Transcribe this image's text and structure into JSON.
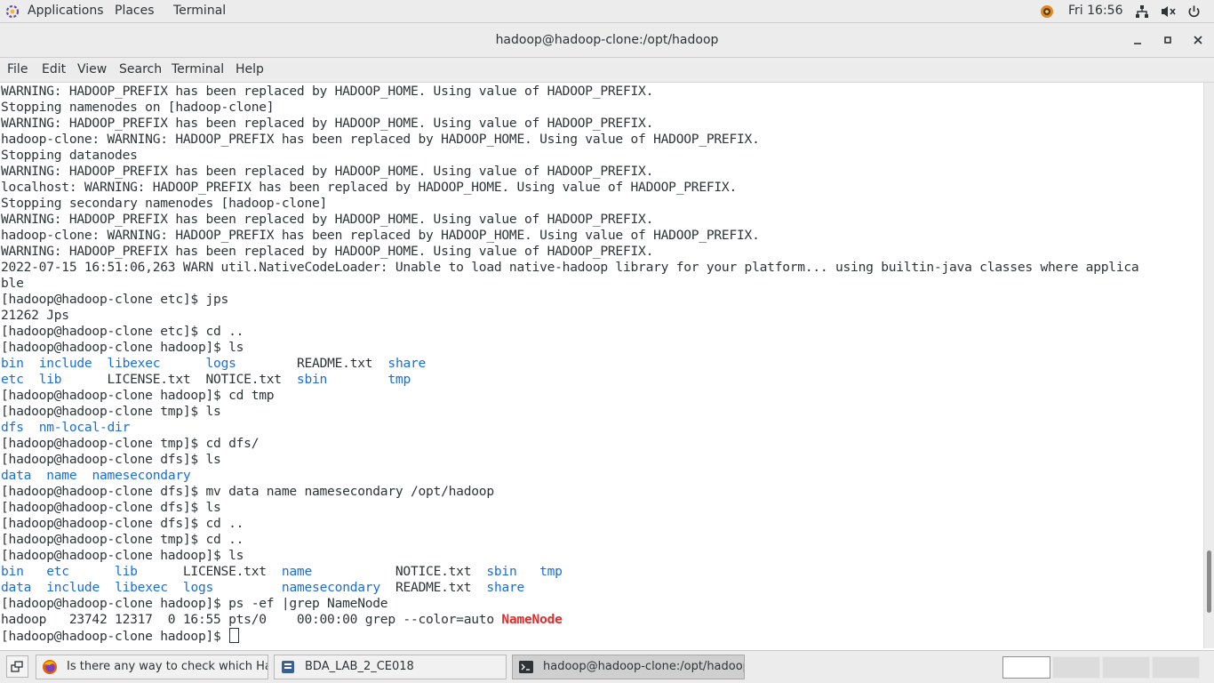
{
  "topbar": {
    "applications": "Applications",
    "places": "Places",
    "terminal": "Terminal",
    "clock": "Fri 16:56"
  },
  "window": {
    "title": "hadoop@hadoop-clone:/opt/hadoop"
  },
  "menubar": {
    "items": [
      "File",
      "Edit",
      "View",
      "Search",
      "Terminal",
      "Help"
    ]
  },
  "terminal": {
    "lines": [
      [
        {
          "t": "WARNING: HADOOP_PREFIX has been replaced by HADOOP_HOME. Using value of HADOOP_PREFIX."
        }
      ],
      [
        {
          "t": "Stopping namenodes on [hadoop-clone]"
        }
      ],
      [
        {
          "t": "WARNING: HADOOP_PREFIX has been replaced by HADOOP_HOME. Using value of HADOOP_PREFIX."
        }
      ],
      [
        {
          "t": "hadoop-clone: WARNING: HADOOP_PREFIX has been replaced by HADOOP_HOME. Using value of HADOOP_PREFIX."
        }
      ],
      [
        {
          "t": "Stopping datanodes"
        }
      ],
      [
        {
          "t": "WARNING: HADOOP_PREFIX has been replaced by HADOOP_HOME. Using value of HADOOP_PREFIX."
        }
      ],
      [
        {
          "t": "localhost: WARNING: HADOOP_PREFIX has been replaced by HADOOP_HOME. Using value of HADOOP_PREFIX."
        }
      ],
      [
        {
          "t": "Stopping secondary namenodes [hadoop-clone]"
        }
      ],
      [
        {
          "t": "WARNING: HADOOP_PREFIX has been replaced by HADOOP_HOME. Using value of HADOOP_PREFIX."
        }
      ],
      [
        {
          "t": "hadoop-clone: WARNING: HADOOP_PREFIX has been replaced by HADOOP_HOME. Using value of HADOOP_PREFIX."
        }
      ],
      [
        {
          "t": "WARNING: HADOOP_PREFIX has been replaced by HADOOP_HOME. Using value of HADOOP_PREFIX."
        }
      ],
      [
        {
          "t": "2022-07-15 16:51:06,263 WARN util.NativeCodeLoader: Unable to load native-hadoop library for your platform... using builtin-java classes where applica"
        }
      ],
      [
        {
          "t": "ble"
        }
      ],
      [
        {
          "t": "[hadoop@hadoop-clone etc]$ jps"
        }
      ],
      [
        {
          "t": "21262 Jps"
        }
      ],
      [
        {
          "t": "[hadoop@hadoop-clone etc]$ cd .."
        }
      ],
      [
        {
          "t": "[hadoop@hadoop-clone hadoop]$ ls"
        }
      ],
      [
        {
          "t": "bin",
          "c": "dir"
        },
        {
          "t": "  "
        },
        {
          "t": "include",
          "c": "dir"
        },
        {
          "t": "  "
        },
        {
          "t": "libexec",
          "c": "dir"
        },
        {
          "t": "      "
        },
        {
          "t": "logs",
          "c": "dir"
        },
        {
          "t": "        README.txt  "
        },
        {
          "t": "share",
          "c": "dir"
        }
      ],
      [
        {
          "t": "etc",
          "c": "dir"
        },
        {
          "t": "  "
        },
        {
          "t": "lib",
          "c": "dir"
        },
        {
          "t": "      LICENSE.txt  NOTICE.txt  "
        },
        {
          "t": "sbin",
          "c": "dir"
        },
        {
          "t": "        "
        },
        {
          "t": "tmp",
          "c": "dir"
        }
      ],
      [
        {
          "t": "[hadoop@hadoop-clone hadoop]$ cd tmp"
        }
      ],
      [
        {
          "t": "[hadoop@hadoop-clone tmp]$ ls"
        }
      ],
      [
        {
          "t": "dfs",
          "c": "dir"
        },
        {
          "t": "  "
        },
        {
          "t": "nm-local-dir",
          "c": "dir"
        }
      ],
      [
        {
          "t": "[hadoop@hadoop-clone tmp]$ cd dfs/"
        }
      ],
      [
        {
          "t": "[hadoop@hadoop-clone dfs]$ ls"
        }
      ],
      [
        {
          "t": "data",
          "c": "dir"
        },
        {
          "t": "  "
        },
        {
          "t": "name",
          "c": "dir"
        },
        {
          "t": "  "
        },
        {
          "t": "namesecondary",
          "c": "dir"
        }
      ],
      [
        {
          "t": "[hadoop@hadoop-clone dfs]$ mv data name namesecondary /opt/hadoop"
        }
      ],
      [
        {
          "t": "[hadoop@hadoop-clone dfs]$ ls"
        }
      ],
      [
        {
          "t": "[hadoop@hadoop-clone dfs]$ cd .."
        }
      ],
      [
        {
          "t": "[hadoop@hadoop-clone tmp]$ cd .."
        }
      ],
      [
        {
          "t": "[hadoop@hadoop-clone hadoop]$ ls"
        }
      ],
      [
        {
          "t": "bin",
          "c": "dir"
        },
        {
          "t": "   "
        },
        {
          "t": "etc",
          "c": "dir"
        },
        {
          "t": "      "
        },
        {
          "t": "lib",
          "c": "dir"
        },
        {
          "t": "      LICENSE.txt  "
        },
        {
          "t": "name",
          "c": "dir"
        },
        {
          "t": "           NOTICE.txt  "
        },
        {
          "t": "sbin",
          "c": "dir"
        },
        {
          "t": "   "
        },
        {
          "t": "tmp",
          "c": "dir"
        }
      ],
      [
        {
          "t": "data",
          "c": "dir"
        },
        {
          "t": "  "
        },
        {
          "t": "include",
          "c": "dir"
        },
        {
          "t": "  "
        },
        {
          "t": "libexec",
          "c": "dir"
        },
        {
          "t": "  "
        },
        {
          "t": "logs",
          "c": "dir"
        },
        {
          "t": "         "
        },
        {
          "t": "namesecondary",
          "c": "dir"
        },
        {
          "t": "  README.txt  "
        },
        {
          "t": "share",
          "c": "dir"
        }
      ],
      [
        {
          "t": "[hadoop@hadoop-clone hadoop]$ ps -ef |grep NameNode"
        }
      ],
      [
        {
          "t": "hadoop   23742 12317  0 16:55 pts/0    00:00:00 grep --color=auto "
        },
        {
          "t": "NameNode",
          "c": "hl"
        }
      ],
      [
        {
          "t": "[hadoop@hadoop-clone hadoop]$ "
        }
      ]
    ],
    "scroll_position": 0.93,
    "scroll_visible_fraction": 0.11
  },
  "taskbar": {
    "tasks": [
      {
        "label": "Is there any way to check which Had...",
        "icon": "firefox-icon",
        "active": false
      },
      {
        "label": "BDA_LAB_2_CE018",
        "icon": "document-icon",
        "active": false
      },
      {
        "label": "hadoop@hadoop-clone:/opt/hadoop",
        "icon": "terminal-icon",
        "active": true
      }
    ],
    "workspaces": 4,
    "active_workspace": 1
  },
  "colors": {
    "directory": "#1a6ed8",
    "grep_match": "#dc2f2f",
    "text": "#2e3436"
  }
}
